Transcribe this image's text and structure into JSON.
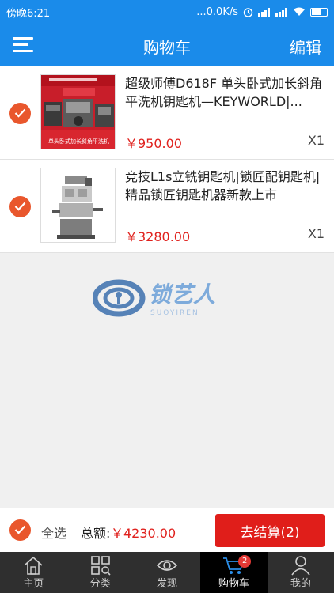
{
  "status_bar": {
    "time": "傍晚6:21",
    "network_speed": "...0.0K/s",
    "signal_bars": 2,
    "battery_level": 0.6
  },
  "nav": {
    "menu_icon": "hamburger-menu-icon",
    "title": "购物车",
    "edit_label": "编辑"
  },
  "cart": {
    "items": [
      {
        "name": "超级师傅D618F 单头卧式加长斜角平洗机钥匙机—KEYWORLD|...",
        "price": "￥950.00",
        "quantity": "X1",
        "checked": true,
        "image_text": "单头卧式加长斜角平洗机"
      },
      {
        "name": "竞技L1s立铣钥匙机|锁匠配钥匙机|精品锁匠钥匙机器新款上市",
        "price": "￥3280.00",
        "quantity": "X1",
        "checked": true
      }
    ]
  },
  "watermark": {
    "text": "锁艺人",
    "subtext": "SUOYIREN"
  },
  "checkout": {
    "select_all_label": "全选",
    "total_label": "总额:",
    "total_value": "￥4230.00",
    "checkout_button": "去结算(2)"
  },
  "tabs": [
    {
      "label": "主页",
      "icon": "home-icon",
      "active": false
    },
    {
      "label": "分类",
      "icon": "category-grid-icon",
      "active": false
    },
    {
      "label": "发现",
      "icon": "eye-icon",
      "active": false
    },
    {
      "label": "购物车",
      "icon": "cart-icon",
      "active": true,
      "badge": "2"
    },
    {
      "label": "我的",
      "icon": "user-icon",
      "active": false
    }
  ],
  "colors": {
    "primary": "#1a8bea",
    "accent": "#e9572d",
    "price": "#e0211d",
    "checkout_button": "#e01e1a",
    "tab_bar": "#2f2f2f"
  }
}
